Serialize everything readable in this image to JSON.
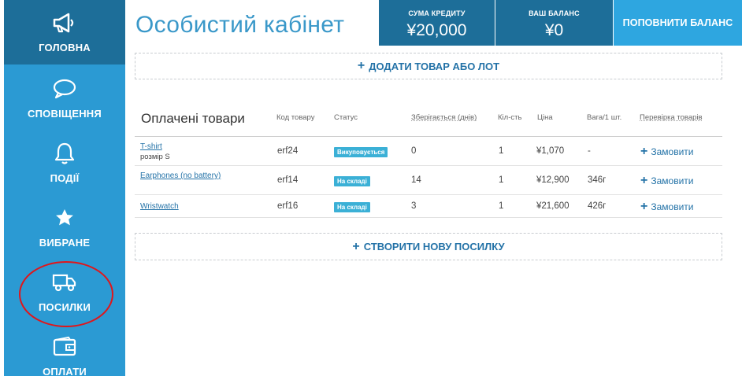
{
  "sidebar": {
    "items": [
      {
        "label": "ГОЛОВНА",
        "icon": "megaphone-icon"
      },
      {
        "label": "СПОВІЩЕННЯ",
        "icon": "speech-bubble-icon"
      },
      {
        "label": "ПОДІЇ",
        "icon": "bell-icon"
      },
      {
        "label": "ВИБРАНЕ",
        "icon": "star-icon"
      },
      {
        "label": "ПОСИЛКИ",
        "icon": "truck-icon"
      },
      {
        "label": "ОПЛАТИ",
        "icon": "wallet-icon"
      }
    ]
  },
  "header": {
    "title": "Особистий кабінет",
    "credit": {
      "label": "СУМА КРЕДИТУ",
      "value": "¥20,000"
    },
    "balance": {
      "label": "ВАШ БАЛАНС",
      "value": "¥0"
    },
    "topup_label": "ПОПОВНИТИ БАЛАНС"
  },
  "actions": {
    "plus": "+",
    "add_item": "ДОДАТИ ТОВАР АБО ЛОТ",
    "create_parcel": "СТВОРИТИ НОВУ ПОСИЛКУ"
  },
  "table": {
    "title": "Оплачені товари",
    "columns": {
      "code": "Код товару",
      "status": "Статус",
      "stored": "Зберігається (днів)",
      "qty": "Кіл-сть",
      "price": "Ціна",
      "weight": "Вага/1 шт.",
      "check": "Перевірка товарів"
    },
    "rows": [
      {
        "name": "T-shirt",
        "sub": "розмір S",
        "code": "erf24",
        "status": "Викуповується",
        "stored": "0",
        "qty": "1",
        "price": "¥1,070",
        "weight": "-",
        "action": "Замовити"
      },
      {
        "name": "Earphones (no battery)",
        "sub": "",
        "code": "erf14",
        "status": "На складі",
        "stored": "14",
        "qty": "1",
        "price": "¥12,900",
        "weight": "346г",
        "action": "Замовити"
      },
      {
        "name": "Wristwatch",
        "sub": "",
        "code": "erf16",
        "status": "На складі",
        "stored": "3",
        "qty": "1",
        "price": "¥21,600",
        "weight": "426г",
        "action": "Замовити"
      }
    ],
    "action_plus": "+"
  },
  "colors": {
    "sidebar": "#2b9ad3",
    "sidebar_active": "#1d6e99",
    "stat_box": "#1d6e99",
    "topup": "#2ea6e0",
    "badge": "#3bb0d6",
    "link": "#2372a7",
    "annotation": "#e0161b"
  }
}
